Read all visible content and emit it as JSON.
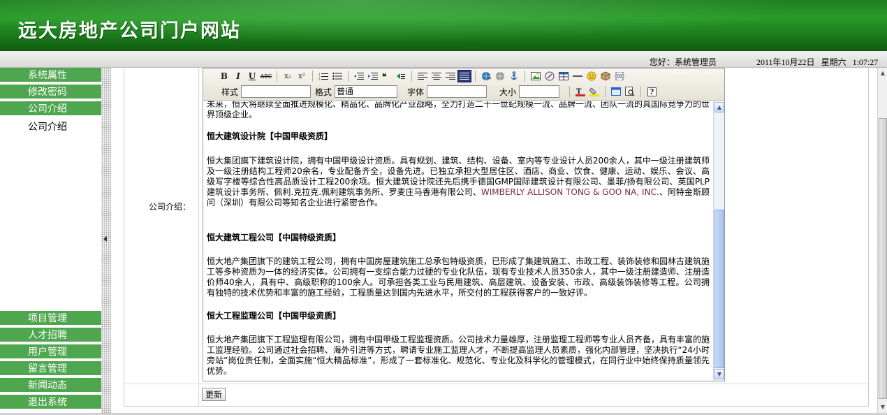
{
  "header": {
    "site_title": "远大房地产公司门户网站"
  },
  "statusbar": {
    "greeting": "您好：系统管理员",
    "date": "2011年10月22日",
    "weekday": "星期六",
    "time": "1:07:27"
  },
  "sidebar": {
    "top_items": [
      {
        "label": "系统属性"
      },
      {
        "label": "修改密码"
      },
      {
        "label": "公司介绍"
      }
    ],
    "sub_items": [
      {
        "label": "公司介绍"
      }
    ],
    "bottom_items": [
      {
        "label": "项目管理"
      },
      {
        "label": "人才招聘"
      },
      {
        "label": "用户管理"
      },
      {
        "label": "留言管理"
      },
      {
        "label": "新闻动态"
      },
      {
        "label": "退出系统"
      }
    ]
  },
  "form": {
    "field_label": "公司介绍：",
    "submit_label": "更新"
  },
  "toolbar": {
    "bold": "B",
    "italic": "I",
    "underline": "U",
    "strike": "ABC",
    "subscript": "x₂",
    "superscript": "x²",
    "style_label": "样式",
    "format_label": "格式",
    "format_value": "普通",
    "font_label": "字体",
    "size_label": "大小",
    "help": "?"
  },
  "content": {
    "intro_tail": "未来，恒大将继续全面推进规模化、精品化、品牌化产业战略，全力打造二十一世纪规模一流、品牌一流、团队一流的具国际竞争力的世界顶级企业。",
    "section1_title": "恒大建筑设计院【中国甲级资质】",
    "section1_body_a": "恒大集团旗下建筑设计院，拥有中国甲级设计资质。具有规划、建筑、结构、设备、室内等专业设计人员200余人，其中一级注册建筑师及一级注册结构工程师20余名，专业配备齐全，设备先进。已独立承担大型居住区、酒店、商业、饮食、健康、运动、娱乐、会议、高级写字楼等综合性高品质设计工程200余项。恒大建筑设计院还先后携手德国GMP国际建筑设计有限公司、墨菲/扬有限公司、英国PLP建筑设计事务所、佩利.克拉克.佩利建筑事务所、罗麦庄马香港有限公司、",
    "section1_body_en": "WIMBERLY ALLISON TONG & GOO NA, INC.",
    "section1_body_b": "、阿特金斯顾问（深圳）有限公司等知名企业进行紧密合作。",
    "section2_title": "恒大建筑工程公司【中国特级资质】",
    "section2_body": "恒大地产集团旗下的建筑工程公司，拥有中国房屋建筑施工总承包特级资质，已形成了集建筑施工、市政工程、装饰装修和园林古建筑施工等多种资质为一体的经济实体。公司拥有一支综合能力过硬的专业化队伍，现有专业技术人员350余人，其中一级注册建造师、注册造价师40余人，具有中、高级职称的100余人。可承担各类工业与民用建筑、高层建筑、设备安装、市政、高级装饰装修等工程。公司拥有独特的技术优势和丰富的施工经验，工程质量达到国内先进水平，所交付的工程获得客户的一致好评。",
    "section3_title": "恒大工程监理公司【中国甲级资质】",
    "section3_body": "恒大地产集团旗下工程监理有限公司，拥有中国甲级工程监理资质。公司技术力量雄厚，注册监理工程师等专业人员齐备，具有丰富的施工监理经验。公司通过社会招聘、海外引进等方式，聘请专业施工监理人才，不断提高监理人员素质，强化内部管理，坚决执行“24小时旁站”岗位责任制，全面实施“恒大精品标准”，形成了一套标准化、规范化、专业化及科学化的管理模式，在同行业中始终保持质量领先优势。"
  },
  "colors": {
    "banner_green": "#1f7d1f",
    "menu_green": "#4ea64e",
    "toolbar_bg": "#ece9d8"
  }
}
